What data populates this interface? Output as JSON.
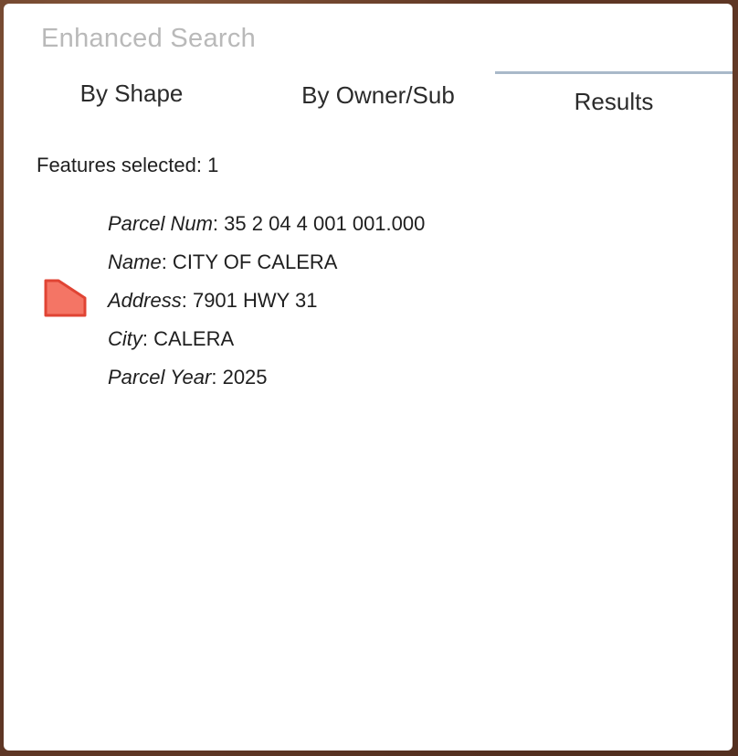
{
  "panel": {
    "title": "Enhanced Search"
  },
  "tabs": [
    {
      "label": "By Shape"
    },
    {
      "label": "By Owner/Sub"
    },
    {
      "label": "Results"
    }
  ],
  "results": {
    "count_text": "Features selected: 1",
    "items": [
      {
        "icon": "parcel-polygon-icon",
        "color": "#f16b5e",
        "attributes": [
          {
            "label": "Parcel Num",
            "sep": ":",
            "value": " 35 2 04 4 001 001.000"
          },
          {
            "label": "Name",
            "sep": ":",
            "value": " CITY OF CALERA"
          },
          {
            "label": "Address",
            "sep": ":",
            "value": " 7901 HWY 31"
          },
          {
            "label": "City",
            "sep": ":",
            "value": " CALERA"
          },
          {
            "label": "Parcel Year",
            "sep": ":",
            "value": " 2025"
          }
        ]
      }
    ]
  }
}
